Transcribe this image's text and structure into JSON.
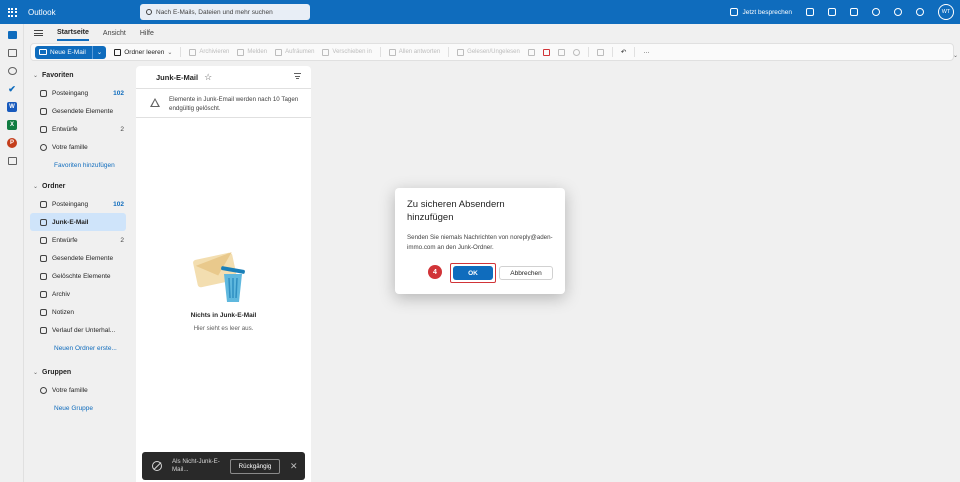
{
  "app": {
    "title": "Outlook"
  },
  "search": {
    "placeholder": "Nach E-Mails, Dateien und mehr suchen"
  },
  "topbar": {
    "meet_label": "Jetzt besprechen",
    "avatar_initials": "WT"
  },
  "tabs": [
    "Startseite",
    "Ansicht",
    "Hilfe"
  ],
  "ribbon": {
    "new_mail": "Neue E-Mail",
    "empty_folder": "Ordner leeren",
    "archive": "Archivieren",
    "report": "Melden",
    "sweep": "Aufräumen",
    "move": "Verschieben in",
    "reply_all": "Allen antworten",
    "mark_read": "Gelesen/Ungelesen",
    "more": "···"
  },
  "favorites": {
    "header": "Favoriten",
    "items": [
      {
        "label": "Posteingang",
        "count": "102"
      },
      {
        "label": "Gesendete Elemente",
        "count": ""
      },
      {
        "label": "Entwürfe",
        "count": "2"
      },
      {
        "label": "Votre famille",
        "count": ""
      }
    ],
    "add_link": "Favoriten hinzufügen"
  },
  "folders": {
    "header": "Ordner",
    "items": [
      {
        "label": "Posteingang",
        "count": "102"
      },
      {
        "label": "Junk-E-Mail",
        "count": ""
      },
      {
        "label": "Entwürfe",
        "count": "2"
      },
      {
        "label": "Gesendete Elemente",
        "count": ""
      },
      {
        "label": "Gelöschte Elemente",
        "count": ""
      },
      {
        "label": "Archiv",
        "count": ""
      },
      {
        "label": "Notizen",
        "count": ""
      },
      {
        "label": "Verlauf der Unterhal...",
        "count": ""
      }
    ],
    "new_folder_link": "Neuen Ordner erste..."
  },
  "groups": {
    "header": "Gruppen",
    "items": [
      {
        "label": "Votre famille"
      }
    ],
    "new_group_link": "Neue Gruppe"
  },
  "message_list": {
    "title": "Junk-E-Mail",
    "info_banner": "Elemente in Junk-Email werden nach 10 Tagen endgültig gelöscht.",
    "empty_title": "Nichts in Junk-E-Mail",
    "empty_subtitle": "Hier sieht es leer aus."
  },
  "dialog": {
    "title": "Zu sicheren Absendern hinzufügen",
    "body": "Senden Sie niemals Nachrichten von noreply@aden-immo.com an den Junk-Ordner.",
    "ok": "OK",
    "cancel": "Abbrechen",
    "step_badge": "4"
  },
  "snackbar": {
    "text": "Als Nicht-Junk-E-Mail...",
    "undo": "Rückgängig",
    "close": "✕"
  },
  "colors": {
    "brand": "#0f6cbd",
    "highlight": "#d13438"
  }
}
